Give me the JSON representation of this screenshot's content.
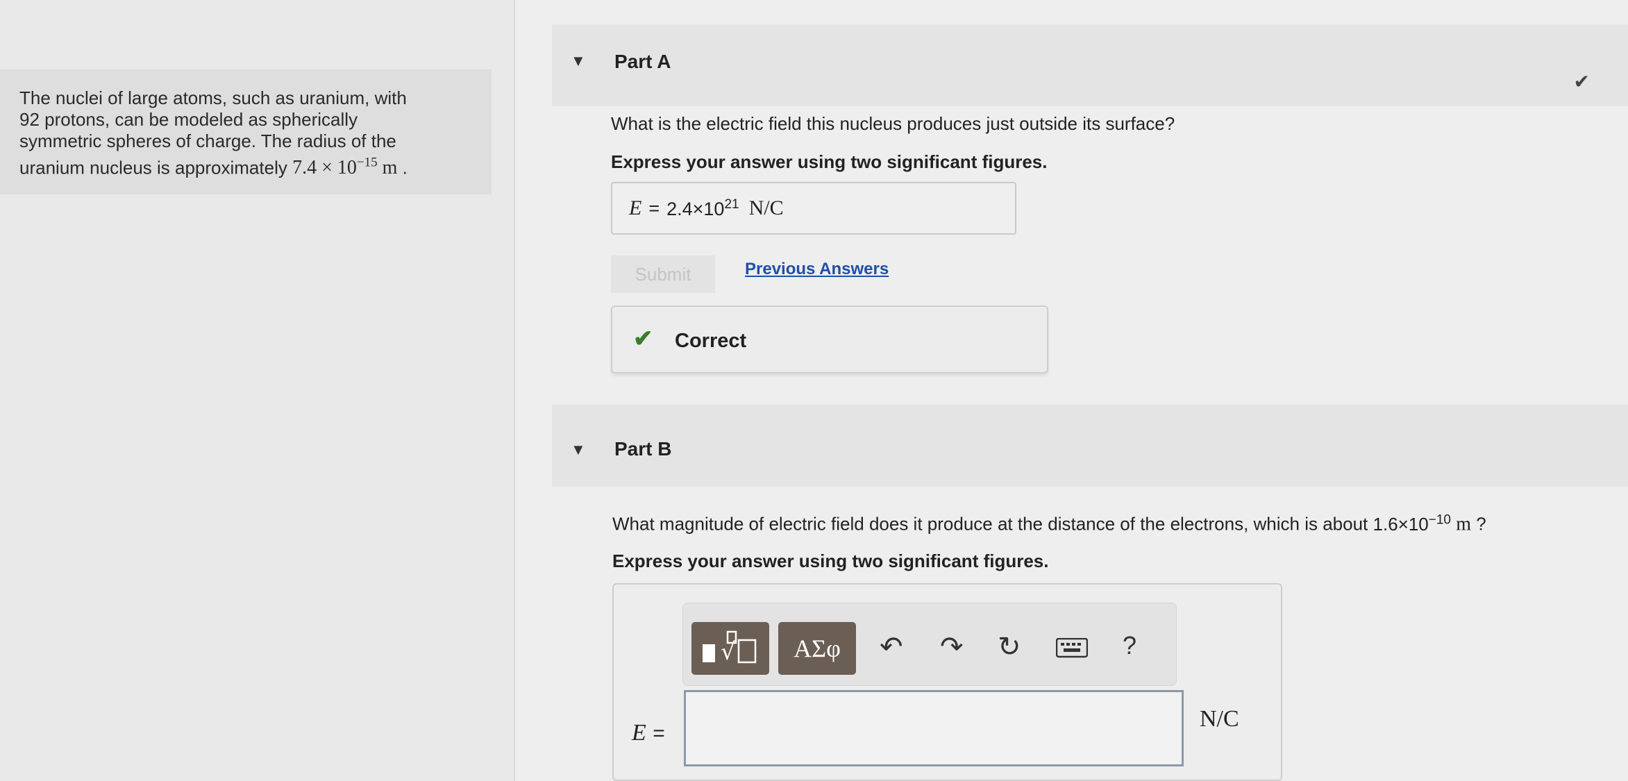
{
  "problem": {
    "text_lines": [
      "The nuclei of large atoms, such as uranium, with",
      "92 protons, can be modeled as spherically",
      "symmetric spheres of charge. The radius of the",
      "uranium nucleus is approximately"
    ],
    "radius_mantissa": "7.4 × 10",
    "radius_exponent": "−15",
    "radius_unit": "m",
    "period": "."
  },
  "part_a": {
    "caret": "▼",
    "title": "Part A",
    "status_icon": "check-icon",
    "question": "What is the electric field this nucleus produces just outside its surface?",
    "instruction": "Express your answer using two significant figures.",
    "answer_label": "E",
    "equals": "=",
    "answer_mantissa": "2.4×10",
    "answer_exponent": "21",
    "answer_unit": "N/C",
    "submit_label": "Submit",
    "previous_answers_label": "Previous Answers",
    "feedback": "Correct"
  },
  "part_b": {
    "caret": "▼",
    "title": "Part B",
    "question_prefix": "What magnitude of electric field does it produce at the distance of the electrons, which is about",
    "distance_mantissa": "1.6×10",
    "distance_exponent": "−10",
    "distance_unit": "m",
    "question_suffix": "?",
    "instruction": "Express your answer using two significant figures.",
    "toolbar": {
      "templates_icon": "templates-icon",
      "greek_label": "ΑΣφ",
      "undo_icon": "undo-icon",
      "redo_icon": "redo-icon",
      "reset_icon": "reset-icon",
      "keyboard_icon": "keyboard-icon",
      "help_label": "?"
    },
    "answer_label": "E",
    "equals": "=",
    "input_value": "",
    "unit": "N/C"
  }
}
